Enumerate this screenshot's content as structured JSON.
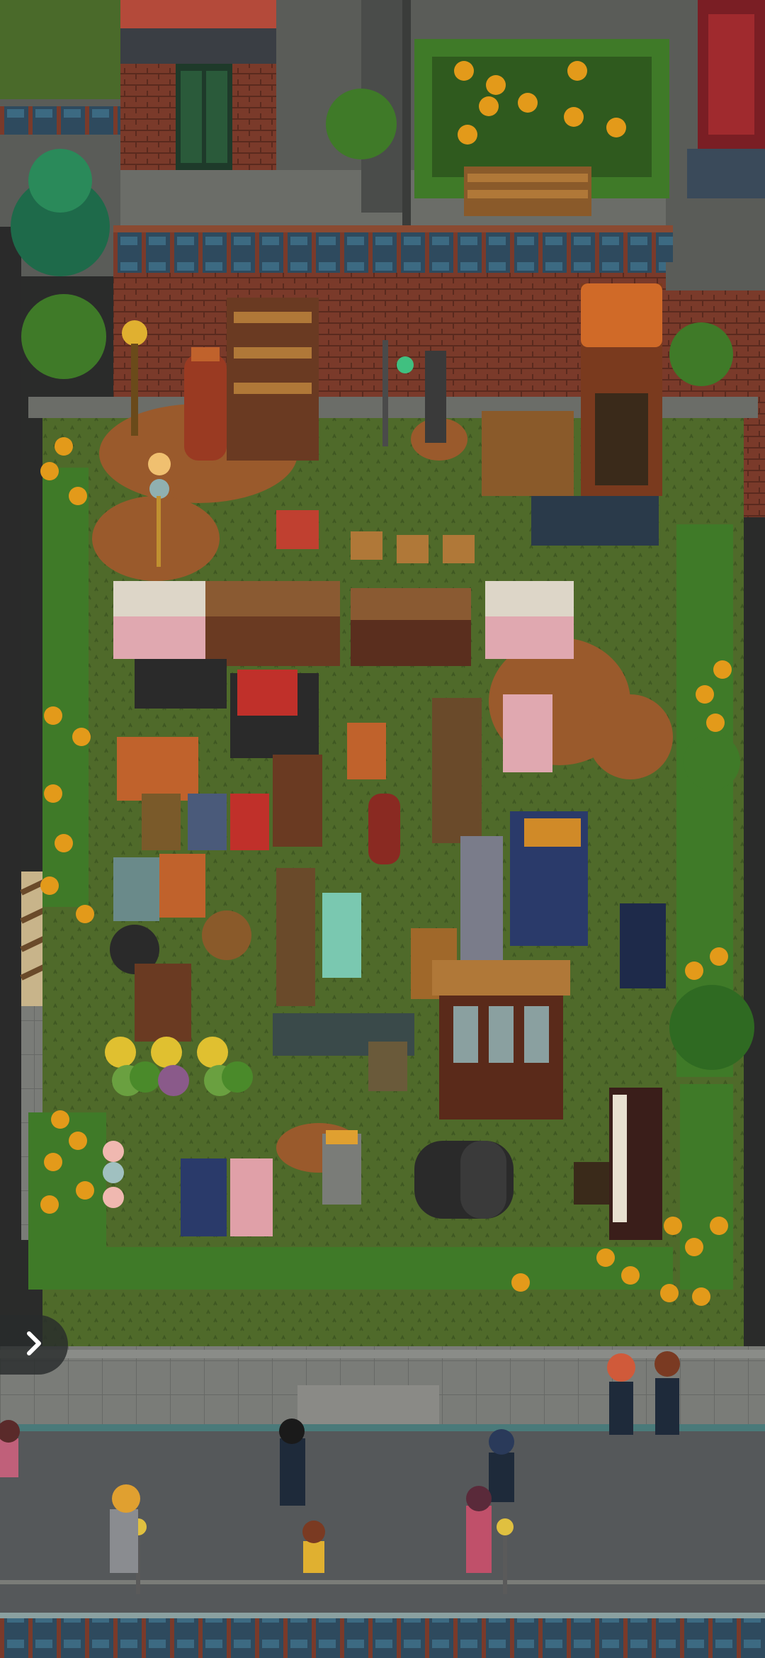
{
  "scene": {
    "type": "top-down pixel-art market yard",
    "colors": {
      "grass": "#4f6a2a",
      "grass_dark": "#3f5822",
      "dirt": "#9a5a2c",
      "brick": "#7a3a2a",
      "street": "#55585a",
      "sidewalk": "#7a7c78",
      "hedge": "#3f7a28",
      "flower": "#e39a1a"
    }
  },
  "ui": {
    "expand_arrow_icon": "chevron-right-icon"
  }
}
